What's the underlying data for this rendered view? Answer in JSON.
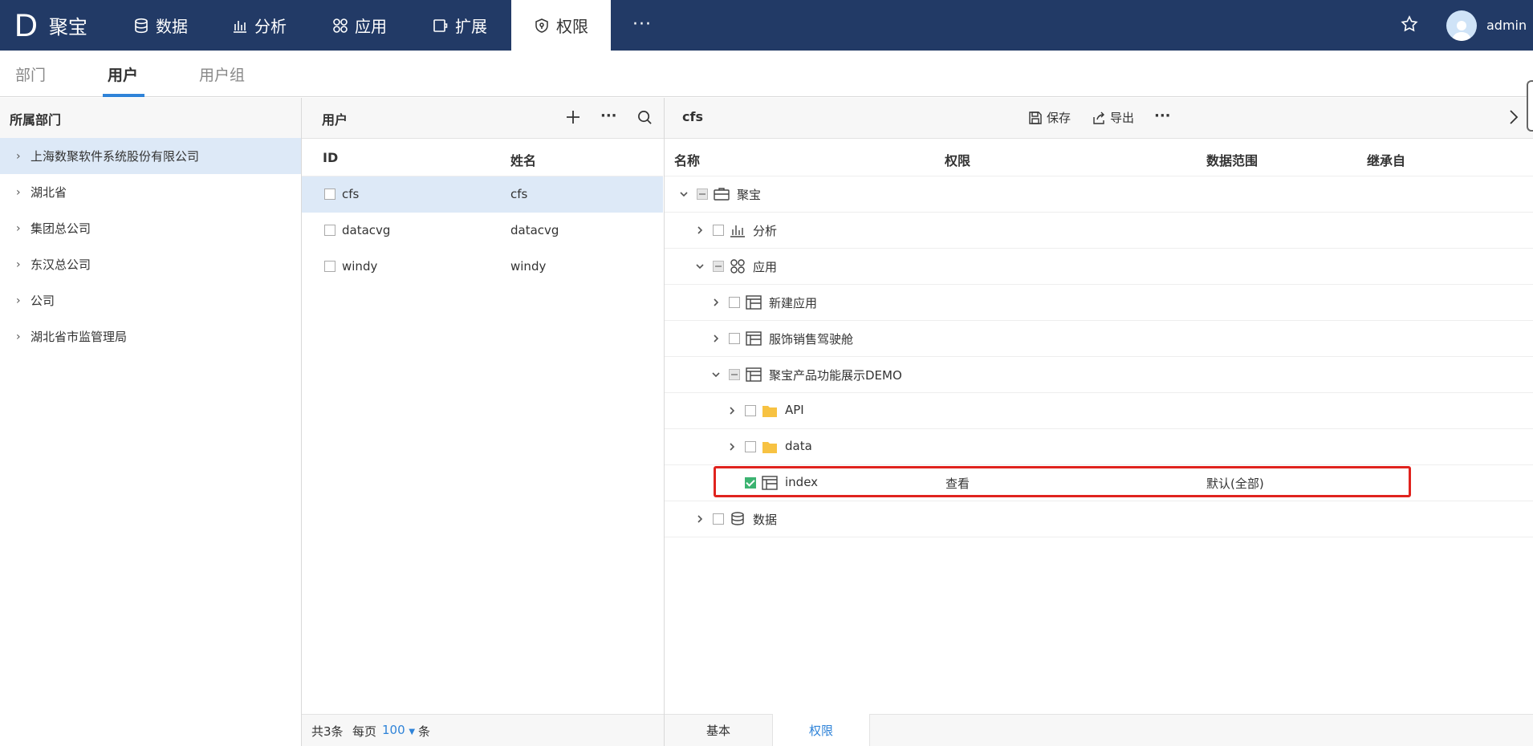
{
  "brand": {
    "logo": "D",
    "name": "聚宝"
  },
  "nav": {
    "items": [
      {
        "label": "数据",
        "icon": "database-icon"
      },
      {
        "label": "分析",
        "icon": "bar-chart-icon"
      },
      {
        "label": "应用",
        "icon": "apps-icon"
      },
      {
        "label": "扩展",
        "icon": "extension-icon"
      },
      {
        "label": "权限",
        "icon": "shield-icon",
        "active": true
      }
    ],
    "more": "···",
    "user": "admin"
  },
  "subtabs": [
    "部门",
    "用户",
    "用户组"
  ],
  "dept_panel": {
    "title": "所属部门",
    "items": [
      "上海数聚软件系统股份有限公司",
      "湖北省",
      "集团总公司",
      "东汉总公司",
      "公司",
      "湖北省市监管理局"
    ]
  },
  "user_panel": {
    "title": "用户",
    "columns": [
      "ID",
      "姓名"
    ],
    "rows": [
      {
        "id": "cfs",
        "name": "cfs"
      },
      {
        "id": "datacvg",
        "name": "datacvg"
      },
      {
        "id": "windy",
        "name": "windy"
      }
    ],
    "footer": {
      "total": "共3条",
      "per_page_label": "每页",
      "per_page": "100",
      "unit": "条"
    }
  },
  "perm_panel": {
    "title": "cfs",
    "save_label": "保存",
    "export_label": "导出",
    "columns": [
      "名称",
      "权限",
      "数据范围",
      "继承自"
    ],
    "rows": [
      {
        "label": "聚宝",
        "perm": "",
        "range": ""
      },
      {
        "label": "分析",
        "perm": "",
        "range": ""
      },
      {
        "label": "应用",
        "perm": "",
        "range": ""
      },
      {
        "label": "新建应用",
        "perm": "",
        "range": ""
      },
      {
        "label": "服饰销售驾驶舱",
        "perm": "",
        "range": ""
      },
      {
        "label": "聚宝产品功能展示DEMO",
        "perm": "",
        "range": ""
      },
      {
        "label": "API",
        "perm": "",
        "range": ""
      },
      {
        "label": "data",
        "perm": "",
        "range": ""
      },
      {
        "label": "index",
        "perm": "查看",
        "range": "默认(全部)"
      },
      {
        "label": "数据",
        "perm": "",
        "range": ""
      }
    ],
    "bottom_tabs": [
      "基本",
      "权限"
    ]
  },
  "colors": {
    "nav_bg": "#223a66",
    "accent": "#2f83d8",
    "selected_bg": "#dde9f7",
    "highlight": "#e0231e",
    "check": "#3cb371"
  }
}
